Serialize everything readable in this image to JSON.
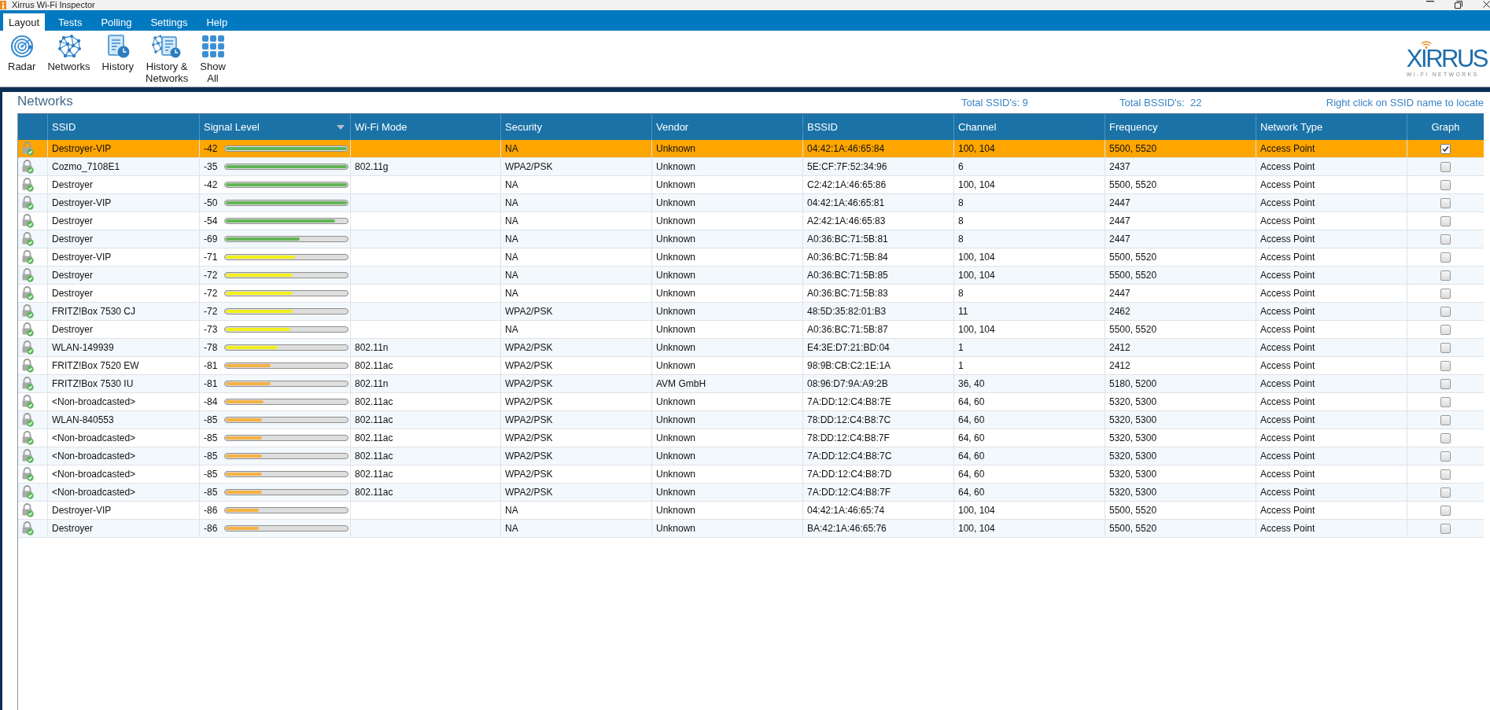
{
  "window": {
    "title": "Xirrus Wi-Fi Inspector"
  },
  "menu_tabs": [
    {
      "label": "Layout",
      "selected": true
    },
    {
      "label": "Tests",
      "selected": false
    },
    {
      "label": "Polling",
      "selected": false
    },
    {
      "label": "Settings",
      "selected": false
    },
    {
      "label": "Help",
      "selected": false
    }
  ],
  "toolbar": [
    {
      "kind": "radar",
      "label": "Radar"
    },
    {
      "kind": "networks",
      "label": "Networks"
    },
    {
      "kind": "history",
      "label": "History"
    },
    {
      "kind": "history_networks",
      "label": "History &\nNetworks"
    },
    {
      "kind": "show_all",
      "label": "Show\nAll"
    }
  ],
  "logo": {
    "name": "XIRRUS",
    "tagline": "WI-FI NETWORKS"
  },
  "panel": {
    "title": "Networks",
    "total_ssids": "Total SSID's: 9",
    "total_bssids": "Total BSSID's:  22",
    "hint": "Right click on SSID name to locate"
  },
  "table": {
    "columns": [
      {
        "label": "SSID",
        "sorted": false
      },
      {
        "label": "Signal Level",
        "sorted": true
      },
      {
        "label": "Wi-Fi Mode",
        "sorted": false
      },
      {
        "label": "Security",
        "sorted": false
      },
      {
        "label": "Vendor",
        "sorted": false
      },
      {
        "label": "BSSID",
        "sorted": false
      },
      {
        "label": "Channel",
        "sorted": false
      },
      {
        "label": "Frequency",
        "sorted": false
      },
      {
        "label": "Network Type",
        "sorted": false
      },
      {
        "label": "Graph",
        "sorted": false
      }
    ],
    "rows": [
      {
        "selected": true,
        "ssid": "Destroyer-VIP",
        "signal": {
          "reading": "-42",
          "level": 1.0,
          "color": "#62b556"
        },
        "security": "NA",
        "vendor": "Unknown",
        "bssid": "04:42:1A:46:65:84",
        "channel": "100, 104",
        "frequency": "5500, 5520",
        "network_type": "Access Point",
        "checked": true
      },
      {
        "selected": false,
        "ssid": "Cozmo_7108E1",
        "signal": {
          "reading": "-35",
          "level": 1.0,
          "color": "#62b556"
        },
        "wifi_mode": "802.11g",
        "security": "WPA2/PSK",
        "vendor": "Unknown",
        "bssid": "5E:CF:7F:52:34:96",
        "channel": "6",
        "frequency": "2437",
        "network_type": "Access Point",
        "checked": false
      },
      {
        "selected": false,
        "ssid": "Destroyer",
        "signal": {
          "reading": "-42",
          "level": 1.0,
          "color": "#62b556"
        },
        "security": "NA",
        "vendor": "Unknown",
        "bssid": "C2:42:1A:46:65:86",
        "channel": "100, 104",
        "frequency": "5500, 5520",
        "network_type": "Access Point",
        "checked": false
      },
      {
        "selected": false,
        "ssid": "Destroyer-VIP",
        "signal": {
          "reading": "-50",
          "level": 1.0,
          "color": "#62b556"
        },
        "security": "NA",
        "vendor": "Unknown",
        "bssid": "04:42:1A:46:65:81",
        "channel": "8",
        "frequency": "2447",
        "network_type": "Access Point",
        "checked": false
      },
      {
        "selected": false,
        "ssid": "Destroyer",
        "signal": {
          "reading": "-54",
          "level": 0.9,
          "color": "#62b556"
        },
        "security": "NA",
        "vendor": "Unknown",
        "bssid": "A2:42:1A:46:65:83",
        "channel": "8",
        "frequency": "2447",
        "network_type": "Access Point",
        "checked": false
      },
      {
        "selected": false,
        "ssid": "Destroyer",
        "signal": {
          "reading": "-69",
          "level": 0.61,
          "color": "#62b556"
        },
        "security": "NA",
        "vendor": "Unknown",
        "bssid": "A0:36:BC:71:5B:81",
        "channel": "8",
        "frequency": "2447",
        "network_type": "Access Point",
        "checked": false
      },
      {
        "selected": false,
        "ssid": "Destroyer-VIP",
        "signal": {
          "reading": "-71",
          "level": 0.57,
          "color": "#f2f01c"
        },
        "security": "NA",
        "vendor": "Unknown",
        "bssid": "A0:36:BC:71:5B:84",
        "channel": "100, 104",
        "frequency": "5500, 5520",
        "network_type": "Access Point",
        "checked": false
      },
      {
        "selected": false,
        "ssid": "Destroyer",
        "signal": {
          "reading": "-72",
          "level": 0.55,
          "color": "#f2f01c"
        },
        "security": "NA",
        "vendor": "Unknown",
        "bssid": "A0:36:BC:71:5B:85",
        "channel": "100, 104",
        "frequency": "5500, 5520",
        "network_type": "Access Point",
        "checked": false
      },
      {
        "selected": false,
        "ssid": "Destroyer",
        "signal": {
          "reading": "-72",
          "level": 0.55,
          "color": "#f2f01c"
        },
        "security": "NA",
        "vendor": "Unknown",
        "bssid": "A0:36:BC:71:5B:83",
        "channel": "8",
        "frequency": "2447",
        "network_type": "Access Point",
        "checked": false
      },
      {
        "selected": false,
        "ssid": "FRITZ!Box 7530 CJ",
        "signal": {
          "reading": "-72",
          "level": 0.55,
          "color": "#f2f01c"
        },
        "security": "WPA2/PSK",
        "vendor": "Unknown",
        "bssid": "48:5D:35:82:01:B3",
        "channel": "11",
        "frequency": "2462",
        "network_type": "Access Point",
        "checked": false
      },
      {
        "selected": false,
        "ssid": "Destroyer",
        "signal": {
          "reading": "-73",
          "level": 0.53,
          "color": "#f2f01c"
        },
        "security": "NA",
        "vendor": "Unknown",
        "bssid": "A0:36:BC:71:5B:87",
        "channel": "100, 104",
        "frequency": "5500, 5520",
        "network_type": "Access Point",
        "checked": false
      },
      {
        "selected": false,
        "ssid": "WLAN-149939",
        "signal": {
          "reading": "-78",
          "level": 0.43,
          "color": "#f2f01c"
        },
        "wifi_mode": "802.11n",
        "security": "WPA2/PSK",
        "vendor": "Unknown",
        "bssid": "E4:3E:D7:21:BD:04",
        "channel": "1",
        "frequency": "2412",
        "network_type": "Access Point",
        "checked": false
      },
      {
        "selected": false,
        "ssid": "FRITZ!Box 7520 EW",
        "signal": {
          "reading": "-81",
          "level": 0.37,
          "color": "#f5b244"
        },
        "wifi_mode": "802.11ac",
        "security": "WPA2/PSK",
        "vendor": "Unknown",
        "bssid": "98:9B:CB:C2:1E:1A",
        "channel": "1",
        "frequency": "2412",
        "network_type": "Access Point",
        "checked": false
      },
      {
        "selected": false,
        "ssid": "FRITZ!Box 7530 IU",
        "signal": {
          "reading": "-81",
          "level": 0.37,
          "color": "#f5b244"
        },
        "wifi_mode": "802.11n",
        "security": "WPA2/PSK",
        "vendor": "AVM GmbH",
        "bssid": "08:96:D7:9A:A9:2B",
        "channel": "36, 40",
        "frequency": "5180, 5200",
        "network_type": "Access Point",
        "checked": false
      },
      {
        "selected": false,
        "ssid": "<Non-broadcasted>",
        "signal": {
          "reading": "-84",
          "level": 0.31,
          "color": "#f5b244"
        },
        "wifi_mode": "802.11ac",
        "security": "WPA2/PSK",
        "vendor": "Unknown",
        "bssid": "7A:DD:12:C4:B8:7E",
        "channel": "64, 60",
        "frequency": "5320, 5300",
        "network_type": "Access Point",
        "checked": false
      },
      {
        "selected": false,
        "ssid": "WLAN-840553",
        "signal": {
          "reading": "-85",
          "level": 0.3,
          "color": "#f5b244"
        },
        "wifi_mode": "802.11ac",
        "security": "WPA2/PSK",
        "vendor": "Unknown",
        "bssid": "78:DD:12:C4:B8:7C",
        "channel": "64, 60",
        "frequency": "5320, 5300",
        "network_type": "Access Point",
        "checked": false
      },
      {
        "selected": false,
        "ssid": "<Non-broadcasted>",
        "signal": {
          "reading": "-85",
          "level": 0.3,
          "color": "#f5b244"
        },
        "wifi_mode": "802.11ac",
        "security": "WPA2/PSK",
        "vendor": "Unknown",
        "bssid": "78:DD:12:C4:B8:7F",
        "channel": "64, 60",
        "frequency": "5320, 5300",
        "network_type": "Access Point",
        "checked": false
      },
      {
        "selected": false,
        "ssid": "<Non-broadcasted>",
        "signal": {
          "reading": "-85",
          "level": 0.3,
          "color": "#f5b244"
        },
        "wifi_mode": "802.11ac",
        "security": "WPA2/PSK",
        "vendor": "Unknown",
        "bssid": "7A:DD:12:C4:B8:7C",
        "channel": "64, 60",
        "frequency": "5320, 5300",
        "network_type": "Access Point",
        "checked": false
      },
      {
        "selected": false,
        "ssid": "<Non-broadcasted>",
        "signal": {
          "reading": "-85",
          "level": 0.3,
          "color": "#f5b244"
        },
        "wifi_mode": "802.11ac",
        "security": "WPA2/PSK",
        "vendor": "Unknown",
        "bssid": "7A:DD:12:C4:B8:7D",
        "channel": "64, 60",
        "frequency": "5320, 5300",
        "network_type": "Access Point",
        "checked": false
      },
      {
        "selected": false,
        "ssid": "<Non-broadcasted>",
        "signal": {
          "reading": "-85",
          "level": 0.3,
          "color": "#f5b244"
        },
        "wifi_mode": "802.11ac",
        "security": "WPA2/PSK",
        "vendor": "Unknown",
        "bssid": "7A:DD:12:C4:B8:7F",
        "channel": "64, 60",
        "frequency": "5320, 5300",
        "network_type": "Access Point",
        "checked": false
      },
      {
        "selected": false,
        "ssid": "Destroyer-VIP",
        "signal": {
          "reading": "-86",
          "level": 0.27,
          "color": "#f5b244"
        },
        "security": "NA",
        "vendor": "Unknown",
        "bssid": "04:42:1A:46:65:74",
        "channel": "100, 104",
        "frequency": "5500, 5520",
        "network_type": "Access Point",
        "checked": false
      },
      {
        "selected": false,
        "ssid": "Destroyer",
        "signal": {
          "reading": "-86",
          "level": 0.27,
          "color": "#f5b244"
        },
        "security": "NA",
        "vendor": "Unknown",
        "bssid": "BA:42:1A:46:65:76",
        "channel": "100, 104",
        "frequency": "5500, 5520",
        "network_type": "Access Point",
        "checked": false
      }
    ]
  }
}
